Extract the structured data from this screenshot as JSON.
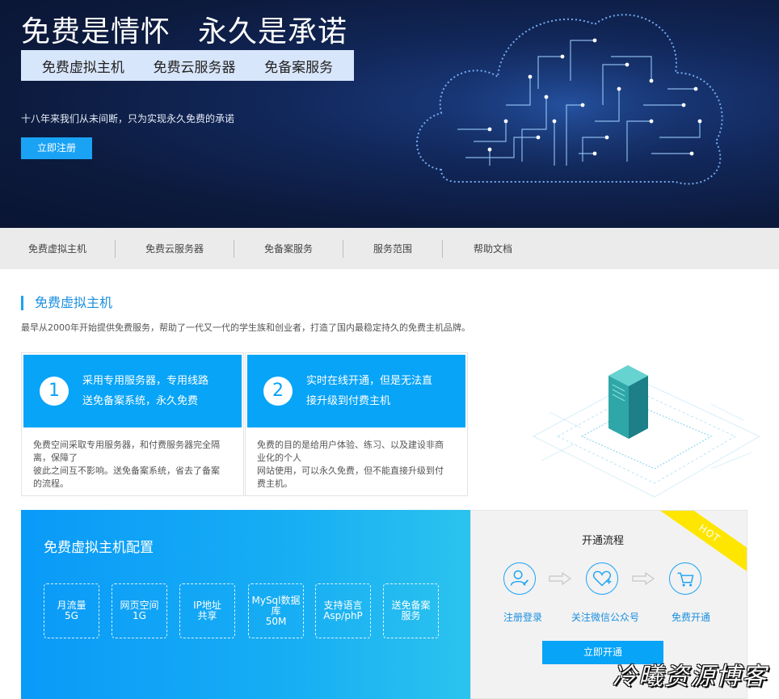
{
  "hero": {
    "title_left": "免费是情怀",
    "title_right": "永久是承诺",
    "pills": [
      "免费虚拟主机",
      "免费云服务器",
      "免备案服务"
    ],
    "subtitle": "十八年来我们从未间断，只为实现永久免费的承诺",
    "register_label": "立即注册"
  },
  "nav": {
    "items": [
      "免费虚拟主机",
      "免费云服务器",
      "免备案服务",
      "服务范围",
      "帮助文档"
    ]
  },
  "section": {
    "title": "免费虚拟主机",
    "description": "最早从2000年开始提供免费服务，帮助了一代又一代的学生族和创业者，打造了国内最稳定持久的免费主机品牌。"
  },
  "cards": [
    {
      "num": "1",
      "head_line1": "采用专用服务器，专用线路",
      "head_line2": "送免备案系统，永久免费",
      "body_lines": [
        "免费空间采取专用服务器，和付费服务器完全隔",
        "离，保障了",
        "彼此之间互不影响。送免备案系统，省去了备案",
        "的流程。"
      ]
    },
    {
      "num": "2",
      "head_line1": "实时在线开通，但是无法直",
      "head_line2": "接升级到付费主机",
      "body_lines": [
        "免费的目的是给用户体验、练习、以及建设非商",
        "业化的个人",
        "网站使用，可以永久免费，但不能直接升级到付",
        "费主机。"
      ]
    }
  ],
  "config": {
    "title": "免费虚拟主机配置",
    "items": [
      {
        "lines": [
          "月流量",
          "5G"
        ]
      },
      {
        "lines": [
          "网页空间",
          "1G"
        ]
      },
      {
        "lines": [
          "IP地址",
          "共享"
        ]
      },
      {
        "lines": [
          "MySql数据",
          "库",
          "50M"
        ]
      },
      {
        "lines": [
          "支持语言",
          "Asp/phP"
        ]
      },
      {
        "lines": [
          "送免备案",
          "服务"
        ]
      }
    ]
  },
  "flow": {
    "title": "开通流程",
    "hot": "HOT",
    "steps": [
      "注册登录",
      "关注微信公众号",
      "免费开通"
    ],
    "button_label": "立即开通",
    "icons": [
      "user-edit-icon",
      "heart-plus-icon",
      "shopping-cart-icon"
    ]
  },
  "watermark": "冷曦资源博客",
  "colors": {
    "accent": "#07a4f8",
    "hero_bg": "#0c1a3d",
    "hot": "#ffe600"
  }
}
